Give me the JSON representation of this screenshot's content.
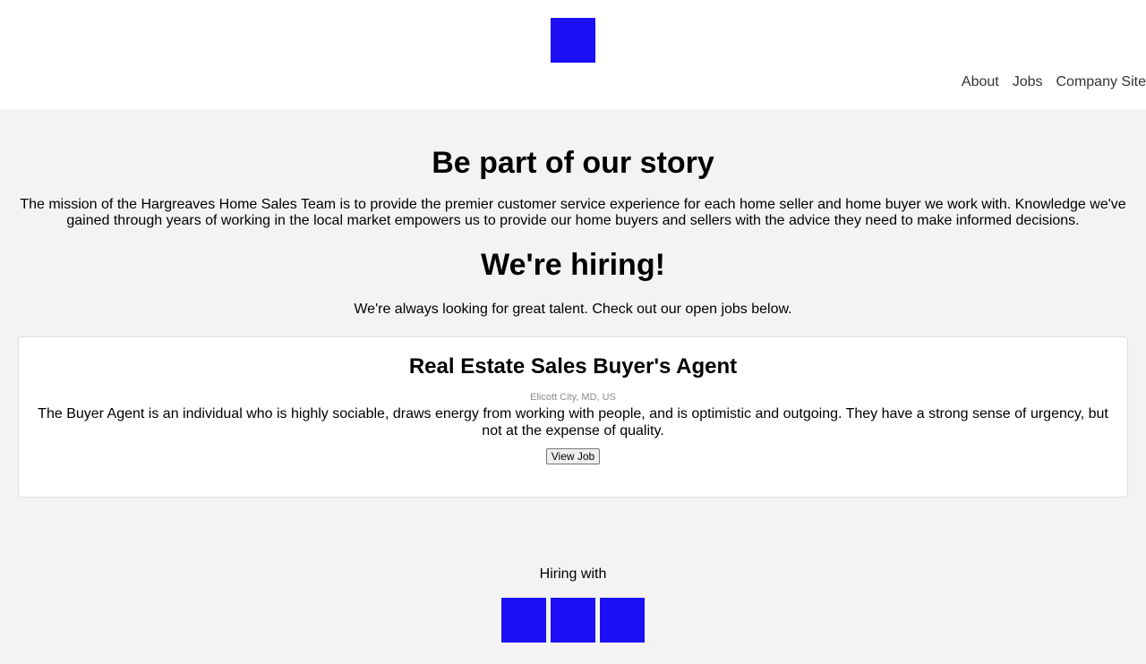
{
  "header": {
    "logo": "company-logo",
    "nav": [
      {
        "label": "About"
      },
      {
        "label": "Jobs"
      },
      {
        "label": "Company Site"
      }
    ]
  },
  "main": {
    "story_title": "Be part of our story",
    "mission": "The mission of the Hargreaves Home Sales Team is to provide the premier customer service experience for each home seller and home buyer we work with. Knowledge we've gained through years of working in the local market empowers us to provide our home buyers and sellers with the advice they need to make informed decisions.",
    "hiring_title": "We're hiring!",
    "hiring_text": "We're always looking for great talent. Check out our open jobs below.",
    "jobs": [
      {
        "title": "Real Estate Sales Buyer's Agent",
        "location": "Elicott City, MD, US",
        "description": "The Buyer Agent is an individual who is highly sociable, draws energy from working with people, and is optimistic and outgoing. They have a strong sense of urgency, but not at the expense of quality.",
        "button_label": "View Job"
      }
    ]
  },
  "footer": {
    "hiring_with": "Hiring with",
    "social_icons": [
      "social-icon-1",
      "social-icon-2",
      "social-icon-3"
    ]
  },
  "colors": {
    "placeholder_blue": "#1c0ff5",
    "background": "#f3f3f3"
  }
}
